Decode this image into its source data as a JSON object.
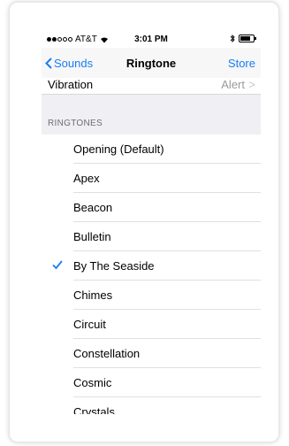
{
  "status": {
    "carrier": "AT&T",
    "time": "3:01 PM"
  },
  "nav": {
    "back_label": "Sounds",
    "title": "Ringtone",
    "right_label": "Store"
  },
  "vibration": {
    "label": "Vibration",
    "value": "Alert"
  },
  "section": {
    "title": "RINGTONES"
  },
  "ringtones": {
    "items": [
      {
        "label": "Opening (Default)",
        "selected": false
      },
      {
        "label": "Apex",
        "selected": false
      },
      {
        "label": "Beacon",
        "selected": false
      },
      {
        "label": "Bulletin",
        "selected": false
      },
      {
        "label": "By The Seaside",
        "selected": true
      },
      {
        "label": "Chimes",
        "selected": false
      },
      {
        "label": "Circuit",
        "selected": false
      },
      {
        "label": "Constellation",
        "selected": false
      },
      {
        "label": "Cosmic",
        "selected": false
      },
      {
        "label": "Crystals",
        "selected": false
      }
    ]
  },
  "colors": {
    "accent": "#1a7cf5"
  }
}
